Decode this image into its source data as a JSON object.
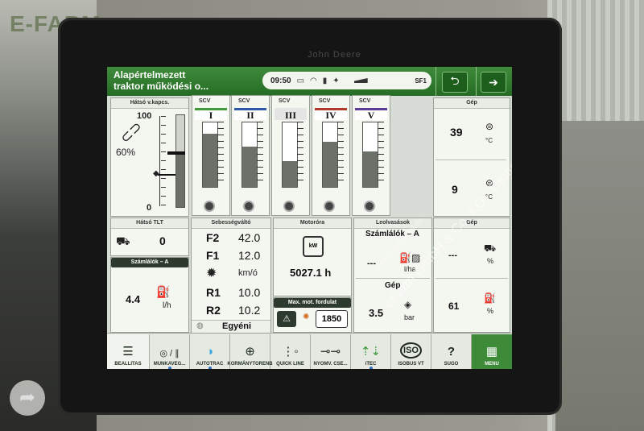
{
  "watermark": {
    "logo": "E-FARM",
    "diagonal": "eFarm GmbH & Co. KG - Deutschland",
    "diagonal2": "www.traktorpool.de",
    "brand": "John Deere"
  },
  "topbar": {
    "title_line1": "Alapértelmezett",
    "title_line2": "traktor működési o...",
    "clock": "09:50",
    "sf_label": "SF1",
    "back_icon": "arrow-left-icon",
    "forward_icon": "arrow-right-icon"
  },
  "hitch": {
    "header": "Hátsó v.kapcs.",
    "max": "100",
    "min": "0",
    "percent": "60%",
    "position": 0.6
  },
  "scv": [
    {
      "header": "SCV",
      "roman": "I",
      "color": "#3f9a3a",
      "level": 0.82
    },
    {
      "header": "SCV",
      "roman": "II",
      "color": "#2c5aa8",
      "level": 0.62
    },
    {
      "header": "SCV",
      "roman": "III",
      "color": "#e5e5e5",
      "level": 0.4
    },
    {
      "header": "SCV",
      "roman": "IV",
      "color": "#b23a2a",
      "level": 0.7
    },
    {
      "header": "SCV",
      "roman": "V",
      "color": "#5d3c9a",
      "level": 0.55
    }
  ],
  "machine_temp": {
    "header": "Gép",
    "value1": "39",
    "unit1": "°C",
    "value2": "9",
    "unit2": "°C"
  },
  "pto": {
    "header": "Hátsó TLT",
    "value": "0"
  },
  "counters_a": {
    "header": "Számlálók – A",
    "value": "4.4",
    "unit": "l/h"
  },
  "transmission": {
    "header": "Sebességváltó",
    "rows": [
      {
        "gear": "F2",
        "speed": "42.0"
      },
      {
        "gear": "F1",
        "speed": "12.0"
      },
      {
        "gear": "R1",
        "speed": "10.0"
      },
      {
        "gear": "R2",
        "speed": "10.2"
      }
    ],
    "unit": "km/ó",
    "mode": "Egyéni"
  },
  "engine": {
    "header": "Motoróra",
    "kw_label": "kW",
    "hours": "5027.1 h",
    "max_header": "Max. mot. fordulat",
    "rpm": "1850"
  },
  "readings": {
    "header": "Leolvasások",
    "counter_title": "Számlálók – A",
    "counter_value": "---",
    "counter_unit": "l/ha",
    "machine_title": "Gép",
    "pressure_value": "3.5",
    "pressure_unit": "bar"
  },
  "machine_right": {
    "header": "Gép",
    "value1": "---",
    "unit1": "%",
    "value2": "61",
    "unit2": "%"
  },
  "bottom_tabs": [
    {
      "label": "BEALLITAS",
      "icon": "list-check-icon"
    },
    {
      "label": "MUNKAVEG...",
      "icon": "pause-icon"
    },
    {
      "label": "AUTOTRAC",
      "icon": "autotrac-icon"
    },
    {
      "label": "KORMÁNYTORENB",
      "icon": "steering-icon"
    },
    {
      "label": "QUICK LINE",
      "icon": "quick-line-icon"
    },
    {
      "label": "NYOMV. CSE...",
      "icon": "track-icon"
    },
    {
      "label": "iTEC",
      "icon": "itec-icon"
    },
    {
      "label": "ISOBUS VT",
      "icon": "isobus-icon"
    },
    {
      "label": "SUGO",
      "icon": "help-icon"
    },
    {
      "label": "MENU",
      "icon": "menu-grid-icon"
    }
  ]
}
